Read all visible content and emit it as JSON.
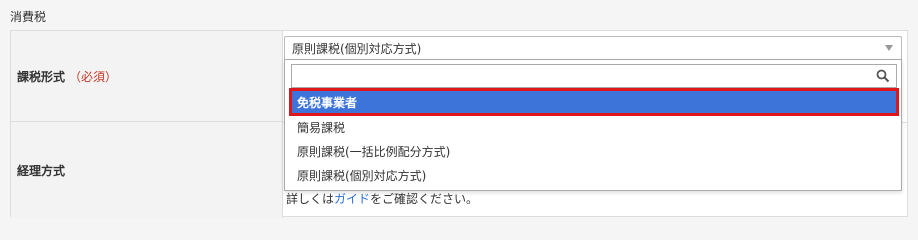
{
  "section_title": "消費税",
  "tax_form": {
    "label": "課税形式",
    "required_note": "（必須）",
    "selected_value": "原則課税(個別対応方式)",
    "search_placeholder": "",
    "options": [
      "免税事業者",
      "簡易課税",
      "原則課税(一括比例配分方式)",
      "原則課税(個別対応方式)"
    ],
    "highlighted_option": "免税事業者"
  },
  "accounting_method": {
    "label": "経理方式",
    "help_prefix": "詳しくは",
    "help_link": "ガイド",
    "help_suffix": "をご確認ください。"
  },
  "colors": {
    "highlight_bg": "#3d74d9",
    "highlight_border": "#e0161b",
    "required": "#c0392b",
    "link": "#2a6fd6"
  }
}
